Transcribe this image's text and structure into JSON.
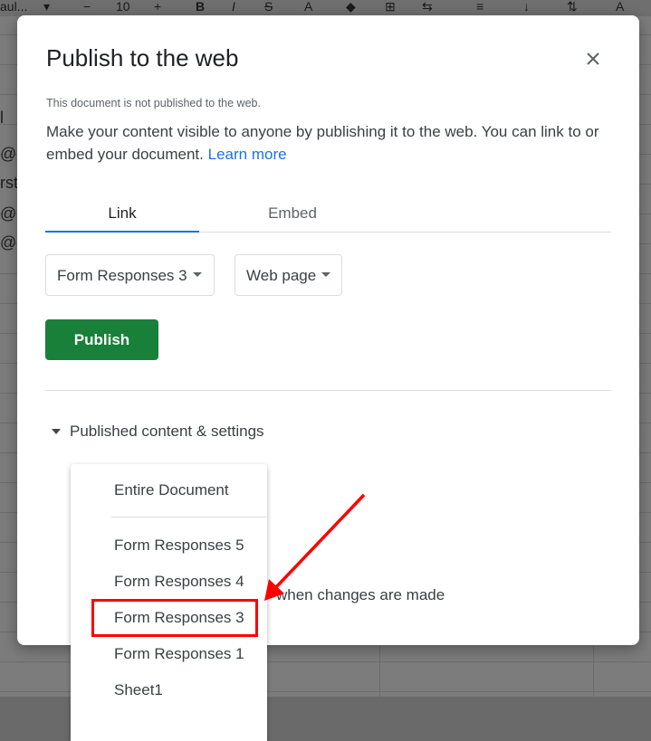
{
  "background": {
    "toolbar_items": [
      "aul...",
      "▾",
      "−",
      "10",
      "+",
      "B",
      "I",
      "S",
      "A",
      "◆",
      "⊞",
      "⇆",
      "≡",
      "↓",
      "⇅",
      "A"
    ],
    "cell_fragments": [
      "l",
      "@g",
      "rst",
      "@g",
      "@g"
    ]
  },
  "dialog": {
    "title": "Publish to the web",
    "close_icon": "close-icon",
    "note": "This document is not published to the web.",
    "description": "Make your content visible to anyone by publishing it to the web. You can link to or embed your document.",
    "learn_more": "Learn more",
    "tabs": [
      {
        "label": "Link",
        "active": true
      },
      {
        "label": "Embed",
        "active": false
      }
    ],
    "sheet_select": "Form Responses 3",
    "format_select": "Web page",
    "publish_button": "Publish",
    "settings_toggle": "Published content & settings",
    "partial_text": "when changes are made"
  },
  "dropdown": {
    "items": [
      "Entire Document",
      "Form Responses 5",
      "Form Responses 4",
      "Form Responses 3",
      "Form Responses 1",
      "Sheet1"
    ]
  },
  "colors": {
    "accent": "#1a73e8",
    "publish": "#188038",
    "annotation": "#ff0000"
  }
}
